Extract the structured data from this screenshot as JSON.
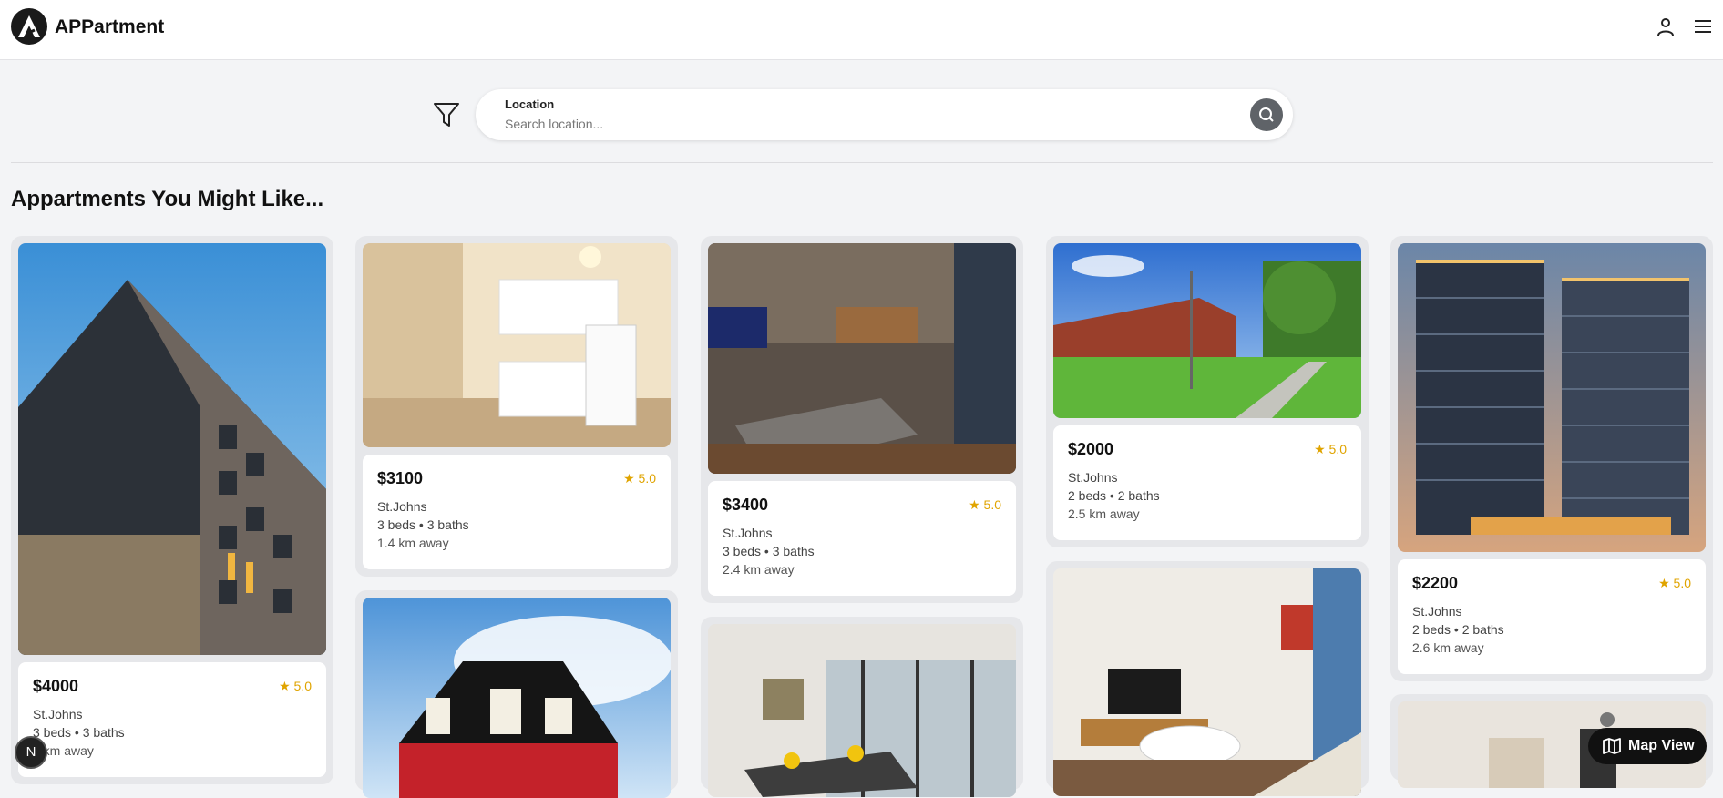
{
  "header": {
    "brand": "APPartment",
    "icons": [
      "user-icon",
      "menu-icon"
    ]
  },
  "search": {
    "label": "Location",
    "placeholder": "Search location...",
    "value": ""
  },
  "section_title": "Appartments You Might Like...",
  "listings": [
    {
      "price": "$4000",
      "rating": "★ 5.0",
      "location": "St.Johns",
      "beds": "3 beds • 3 baths",
      "distance": "0 km away"
    },
    {
      "price": "$3100",
      "rating": "★ 5.0",
      "location": "St.Johns",
      "beds": "3 beds • 3 baths",
      "distance": "1.4 km away"
    },
    {
      "price": "$3400",
      "rating": "★ 5.0",
      "location": "St.Johns",
      "beds": "3 beds • 3 baths",
      "distance": "2.4 km away"
    },
    {
      "price": "$2000",
      "rating": "★ 5.0",
      "location": "St.Johns",
      "beds": "2 beds • 2 baths",
      "distance": "2.5 km away"
    },
    {
      "price": "$2200",
      "rating": "★ 5.0",
      "location": "St.Johns",
      "beds": "2 beds • 2 baths",
      "distance": "2.6 km away"
    }
  ],
  "floating": {
    "avatar_letter": "N",
    "map_label": "Map View"
  },
  "colors": {
    "accent": "#111111",
    "rating": "#e0a400",
    "card_bg": "#e6e7ea",
    "page_bg": "#f3f4f6"
  }
}
